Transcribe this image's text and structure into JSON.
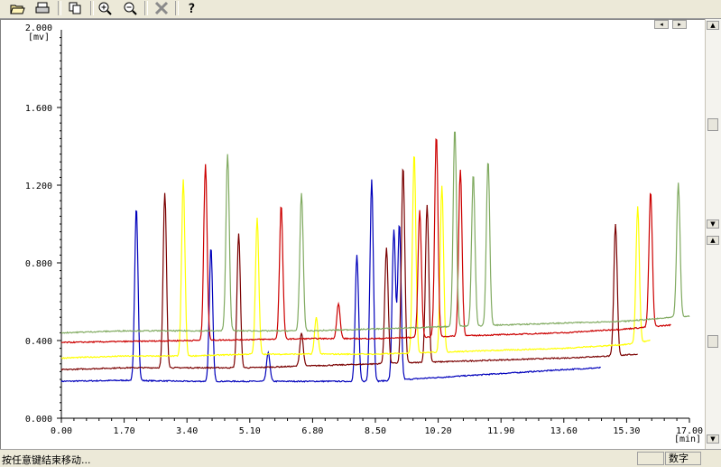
{
  "toolbar": {
    "icons": [
      "open-folder-icon",
      "print-icon",
      "copy-icon",
      "zoom-in-icon",
      "zoom-out-icon",
      "close-icon",
      "help-icon"
    ]
  },
  "status": {
    "message": "按任意键结束移动...",
    "mode": "数字"
  },
  "chart_data": {
    "type": "line",
    "y_top_label": "2.000",
    "y_unit": "[mv]",
    "x_unit": "[min]",
    "xlim": [
      0,
      17
    ],
    "ylim": [
      0,
      2
    ],
    "x_ticks": [
      "0.00",
      "1.70",
      "3.40",
      "5.10",
      "6.80",
      "8.50",
      "10.20",
      "11.90",
      "13.60",
      "15.30",
      "17.00"
    ],
    "y_ticks": [
      "0.000",
      "0.400",
      "0.800",
      "1.200",
      "1.600"
    ],
    "grid": false,
    "series": [
      {
        "color": "#0000bb",
        "base": [
          [
            0,
            0.19
          ],
          [
            1.7,
            0.195
          ],
          [
            3.4,
            0.19
          ],
          [
            5.1,
            0.19
          ],
          [
            6.8,
            0.19
          ],
          [
            8.5,
            0.19
          ],
          [
            10.2,
            0.21
          ],
          [
            11.9,
            0.23
          ],
          [
            13.6,
            0.25
          ],
          [
            14.6,
            0.26
          ]
        ],
        "end": 14.6,
        "peaks": [
          [
            2.03,
            1.09
          ],
          [
            4.05,
            0.88
          ],
          [
            5.6,
            0.34
          ],
          [
            8.0,
            0.84
          ],
          [
            8.4,
            1.23
          ],
          [
            9.0,
            0.97
          ],
          [
            9.15,
            1.0
          ]
        ]
      },
      {
        "color": "#7a0000",
        "base": [
          [
            0,
            0.25
          ],
          [
            1.7,
            0.26
          ],
          [
            3.4,
            0.26
          ],
          [
            5.1,
            0.26
          ],
          [
            6.8,
            0.27
          ],
          [
            8.5,
            0.28
          ],
          [
            10.2,
            0.29
          ],
          [
            11.9,
            0.3
          ],
          [
            13.6,
            0.31
          ],
          [
            14.8,
            0.32
          ],
          [
            15.6,
            0.33
          ]
        ],
        "end": 15.6,
        "peaks": [
          [
            2.8,
            1.16
          ],
          [
            4.8,
            0.95
          ],
          [
            6.5,
            0.44
          ],
          [
            8.8,
            0.88
          ],
          [
            9.25,
            1.3
          ],
          [
            9.9,
            1.1
          ],
          [
            15.0,
            1.0
          ]
        ]
      },
      {
        "color": "#ffff00",
        "base": [
          [
            0,
            0.31
          ],
          [
            1.7,
            0.32
          ],
          [
            3.4,
            0.32
          ],
          [
            5.1,
            0.33
          ],
          [
            6.8,
            0.33
          ],
          [
            8.5,
            0.33
          ],
          [
            10.2,
            0.34
          ],
          [
            11.9,
            0.35
          ],
          [
            13.6,
            0.36
          ],
          [
            15.3,
            0.38
          ],
          [
            15.95,
            0.4
          ]
        ],
        "end": 15.95,
        "peaks": [
          [
            3.3,
            1.23
          ],
          [
            5.3,
            1.03
          ],
          [
            6.9,
            0.52
          ],
          [
            9.55,
            1.37
          ],
          [
            10.3,
            1.2
          ],
          [
            15.6,
            1.09
          ]
        ]
      },
      {
        "color": "#cc0000",
        "base": [
          [
            0,
            0.39
          ],
          [
            1.7,
            0.395
          ],
          [
            3.4,
            0.4
          ],
          [
            5.1,
            0.405
          ],
          [
            6.8,
            0.41
          ],
          [
            8.5,
            0.41
          ],
          [
            10.2,
            0.42
          ],
          [
            11.9,
            0.43
          ],
          [
            13.6,
            0.44
          ],
          [
            15.3,
            0.46
          ],
          [
            16.5,
            0.48
          ]
        ],
        "end": 16.5,
        "peaks": [
          [
            3.9,
            1.31
          ],
          [
            5.95,
            1.1
          ],
          [
            7.5,
            0.59
          ],
          [
            9.7,
            1.07
          ],
          [
            10.15,
            1.46
          ],
          [
            10.8,
            1.28
          ],
          [
            15.95,
            1.17
          ]
        ]
      },
      {
        "color": "#80aa60",
        "base": [
          [
            0,
            0.44
          ],
          [
            1.7,
            0.45
          ],
          [
            3.4,
            0.45
          ],
          [
            5.1,
            0.45
          ],
          [
            6.8,
            0.45
          ],
          [
            8.5,
            0.46
          ],
          [
            10.2,
            0.47
          ],
          [
            11.9,
            0.48
          ],
          [
            13.6,
            0.49
          ],
          [
            15.3,
            0.5
          ],
          [
            16.6,
            0.52
          ],
          [
            17.0,
            0.525
          ]
        ],
        "end": 17.0,
        "peaks": [
          [
            4.5,
            1.36
          ],
          [
            6.5,
            1.16
          ],
          [
            10.65,
            1.5
          ],
          [
            11.15,
            1.26
          ],
          [
            11.55,
            1.33
          ],
          [
            16.7,
            1.21
          ]
        ]
      }
    ]
  }
}
